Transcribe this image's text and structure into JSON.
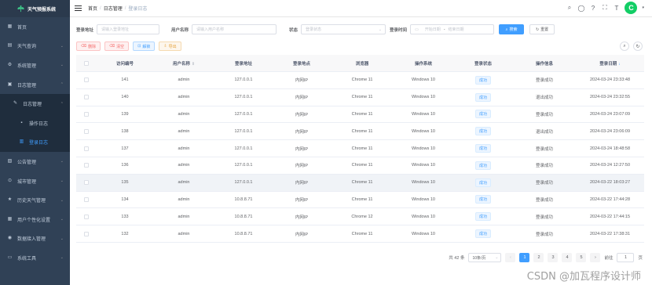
{
  "app": {
    "title": "天气预报系统"
  },
  "sidebar": {
    "items": [
      {
        "label": "首页",
        "icon": "dashboard-icon",
        "glyph": "▦",
        "arrow": ""
      },
      {
        "label": "天气查询",
        "icon": "search-icon",
        "glyph": "▤",
        "arrow": "⌄"
      },
      {
        "label": "系统管理",
        "icon": "gear-icon",
        "glyph": "⚙",
        "arrow": "⌄"
      },
      {
        "label": "日志管理",
        "icon": "log-icon",
        "glyph": "▣",
        "arrow": "⌃"
      },
      {
        "label": "日志管理",
        "icon": "edit-icon",
        "glyph": "✎",
        "arrow": "⌃"
      },
      {
        "label": "操作日志",
        "icon": "form-icon",
        "glyph": "▪",
        "arrow": ""
      },
      {
        "label": "登录日志",
        "icon": "login-log-icon",
        "glyph": "▥",
        "arrow": ""
      },
      {
        "label": "公告管理",
        "icon": "notice-icon",
        "glyph": "▧",
        "arrow": "⌄"
      },
      {
        "label": "城市管理",
        "icon": "location-icon",
        "glyph": "⊙",
        "arrow": "⌄"
      },
      {
        "label": "历史天气管理",
        "icon": "star-icon",
        "glyph": "★",
        "arrow": "⌄"
      },
      {
        "label": "用户个性化设置",
        "icon": "grid-icon",
        "glyph": "▦",
        "arrow": "⌄"
      },
      {
        "label": "数据接入管理",
        "icon": "data-icon",
        "glyph": "◉",
        "arrow": "⌄"
      },
      {
        "label": "系统工具",
        "icon": "tool-icon",
        "glyph": "▭",
        "arrow": "⌄"
      }
    ]
  },
  "breadcrumb": {
    "home": "首页",
    "sep1": "/",
    "mid": "日志管理",
    "sep2": "/",
    "current": "登录日志"
  },
  "header_icons": {
    "search": "⌕",
    "github": "◯",
    "doc": "?",
    "fullscreen": "⛶",
    "size": "T",
    "caret": "▾"
  },
  "user": {
    "avatar_letter": "C"
  },
  "search": {
    "ip_label": "登录地址",
    "ip_placeholder": "请输入登录地址",
    "user_label": "用户名称",
    "user_placeholder": "请输入用户名称",
    "status_label": "状态",
    "status_placeholder": "登录状态",
    "time_label": "登录时间",
    "start_placeholder": "开始日期",
    "range_sep": "-",
    "end_placeholder": "结束日期",
    "search_btn": "搜索",
    "reset_btn": "重置",
    "search_glyph": "⌕",
    "reset_glyph": "↻",
    "calendar_glyph": "▭",
    "dropdown_glyph": "⌄"
  },
  "toolbar": {
    "delete": "删除",
    "clear": "清空",
    "unlock": "解锁",
    "export": "导出",
    "delete_glyph": "⌫",
    "clear_glyph": "⌫",
    "unlock_glyph": "⊡",
    "export_glyph": "⇩",
    "search_toggle_glyph": "⌕",
    "refresh_glyph": "↻"
  },
  "table": {
    "columns": [
      "访问编号",
      "用户名称",
      "登录地址",
      "登录地点",
      "浏览器",
      "操作系统",
      "登录状态",
      "操作信息",
      "登录日期"
    ],
    "sort_neutral": "⇕",
    "sort_desc": "↓",
    "rows": [
      [
        "141",
        "admin",
        "127.0.0.1",
        "内网IP",
        "Chrome 11",
        "Windows 10",
        "成功",
        "登录成功",
        "2024-03-24 23:33:48"
      ],
      [
        "140",
        "admin",
        "127.0.0.1",
        "内网IP",
        "Chrome 11",
        "Windows 10",
        "成功",
        "退出成功",
        "2024-03-24 23:32:55"
      ],
      [
        "139",
        "admin",
        "127.0.0.1",
        "内网IP",
        "Chrome 11",
        "Windows 10",
        "成功",
        "登录成功",
        "2024-03-24 23:07:09"
      ],
      [
        "138",
        "admin",
        "127.0.0.1",
        "内网IP",
        "Chrome 11",
        "Windows 10",
        "成功",
        "退出成功",
        "2024-03-24 23:06:09"
      ],
      [
        "137",
        "admin",
        "127.0.0.1",
        "内网IP",
        "Chrome 11",
        "Windows 10",
        "成功",
        "登录成功",
        "2024-03-24 18:48:58"
      ],
      [
        "136",
        "admin",
        "127.0.0.1",
        "内网IP",
        "Chrome 11",
        "Windows 10",
        "成功",
        "登录成功",
        "2024-03-24 12:27:50"
      ],
      [
        "135",
        "admin",
        "127.0.0.1",
        "内网IP",
        "Chrome 11",
        "Windows 10",
        "成功",
        "登录成功",
        "2024-03-22 18:03:27"
      ],
      [
        "134",
        "admin",
        "10.8.8.71",
        "内网IP",
        "Chrome 11",
        "Windows 10",
        "成功",
        "登录成功",
        "2024-03-22 17:44:28"
      ],
      [
        "133",
        "admin",
        "10.8.8.71",
        "内网IP",
        "Chrome 12",
        "Windows 10",
        "成功",
        "登录成功",
        "2024-03-22 17:44:15"
      ],
      [
        "132",
        "admin",
        "10.8.8.71",
        "内网IP",
        "Chrome 11",
        "Windows 10",
        "成功",
        "登录成功",
        "2024-03-22 17:38:31"
      ]
    ]
  },
  "pagination": {
    "total": "共 42 条",
    "page_size": "10条/页",
    "pages": [
      "1",
      "2",
      "3",
      "4",
      "5"
    ],
    "current": "1",
    "prev": "‹",
    "next": "›",
    "goto_label": "前往",
    "goto_value": "1",
    "goto_suffix": "页"
  },
  "watermark": "CSDN @加瓦程序设计师"
}
